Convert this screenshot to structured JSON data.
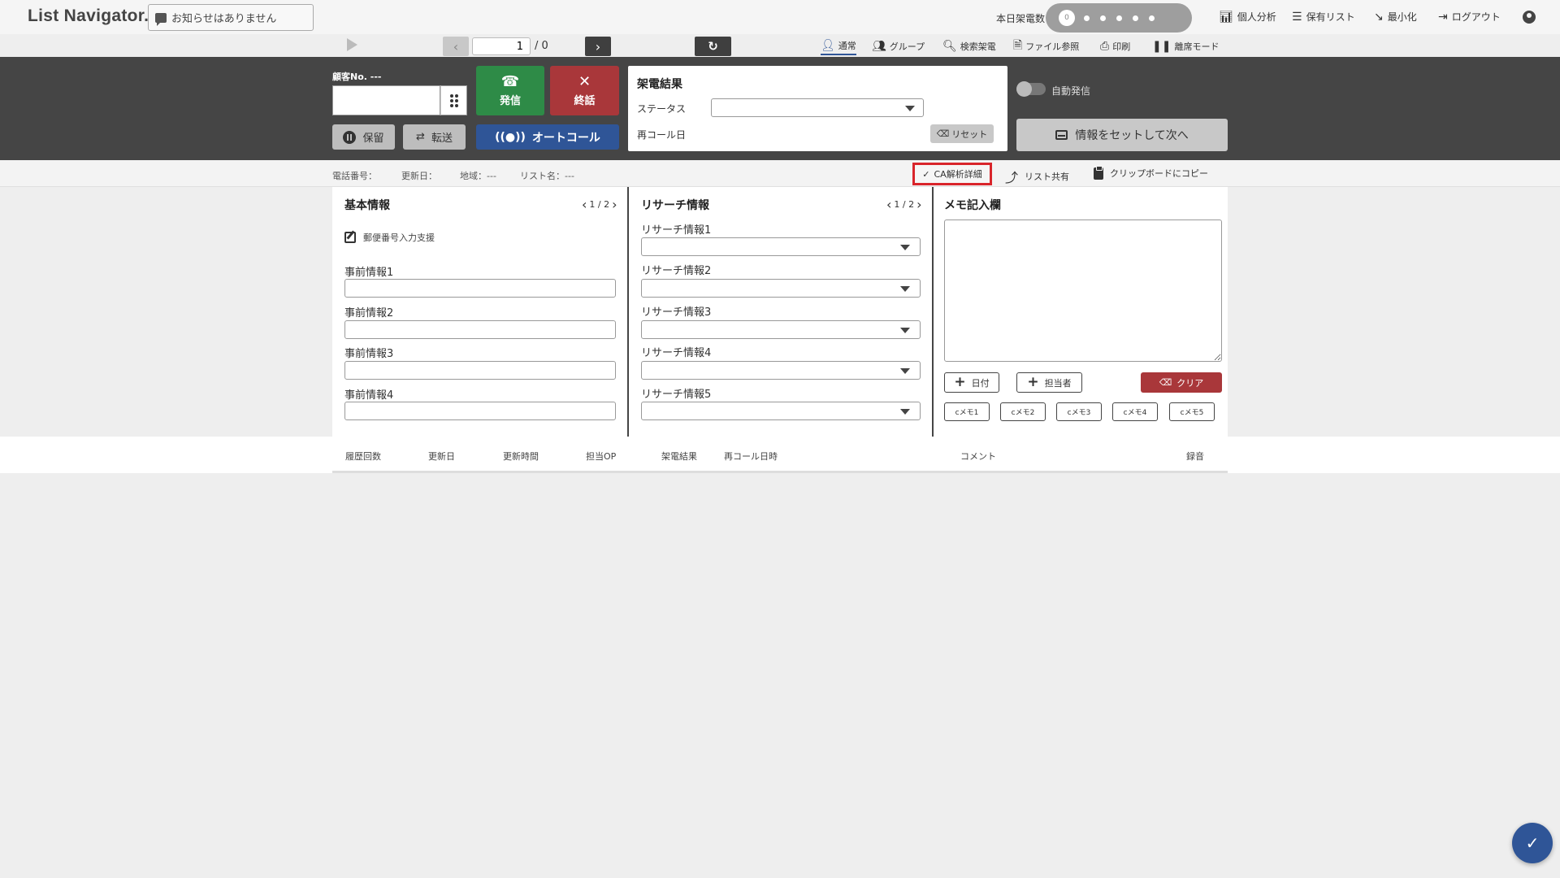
{
  "header": {
    "logo": "List Navigator.",
    "notice": "お知らせはありません",
    "calls_label": "本日架電数",
    "calls_count": "0",
    "menu": [
      "個人分析",
      "保有リスト",
      "最小化",
      "ログアウト"
    ]
  },
  "toolbar": {
    "page_current": "1",
    "page_total": "/ 0",
    "modes": [
      "通常",
      "グループ",
      "検索架電",
      "ファイル参照",
      "印刷",
      "離席モード"
    ],
    "active_mode": "通常"
  },
  "call_panel": {
    "customer_label": "顧客No. ---",
    "customer_value": "",
    "dial_label": "発信",
    "end_label": "終話",
    "hold_label": "保留",
    "transfer_label": "転送",
    "autocall_label": "オートコール",
    "result": {
      "title": "架電結果",
      "status_label": "ステータス",
      "status_value": "",
      "recall_label": "再コール日",
      "reset_label": "リセット"
    },
    "auto_dial_label": "自動発信",
    "auto_dial_on": false,
    "next_label": "情報をセットして次へ"
  },
  "info_bar": {
    "phone": "電話番号：",
    "updated": "更新日：",
    "region": "地域：---",
    "list_name": "リスト名：---",
    "ca_detail": "CA解析詳細",
    "list_share": "リスト共有",
    "clipboard": "クリップボードにコピー"
  },
  "basic_info": {
    "title": "基本情報",
    "pager": "1 / 2",
    "postal_assist": "郵便番号入力支援",
    "fields": [
      {
        "label": "事前情報1",
        "value": ""
      },
      {
        "label": "事前情報2",
        "value": ""
      },
      {
        "label": "事前情報3",
        "value": ""
      },
      {
        "label": "事前情報4",
        "value": ""
      }
    ]
  },
  "research_info": {
    "title": "リサーチ情報",
    "pager": "1 / 2",
    "fields": [
      {
        "label": "リサーチ情報1",
        "value": ""
      },
      {
        "label": "リサーチ情報2",
        "value": ""
      },
      {
        "label": "リサーチ情報3",
        "value": ""
      },
      {
        "label": "リサーチ情報4",
        "value": ""
      },
      {
        "label": "リサーチ情報5",
        "value": ""
      }
    ]
  },
  "memo": {
    "title": "メモ記入欄",
    "value": "",
    "date_label": "日付",
    "owner_label": "担当者",
    "clear_label": "クリア",
    "cmemo": [
      "cメモ1",
      "cメモ2",
      "cメモ3",
      "cメモ4",
      "cメモ5"
    ]
  },
  "history": {
    "columns": [
      "履歴回数",
      "更新日",
      "更新時間",
      "担当OP",
      "架電結果",
      "再コール日時",
      "コメント",
      "録音"
    ]
  },
  "colors": {
    "dial": "#2e8b47",
    "end": "#a9373a",
    "autocall": "#2f5597",
    "highlight": "#d9252b",
    "panel": "#454545"
  }
}
